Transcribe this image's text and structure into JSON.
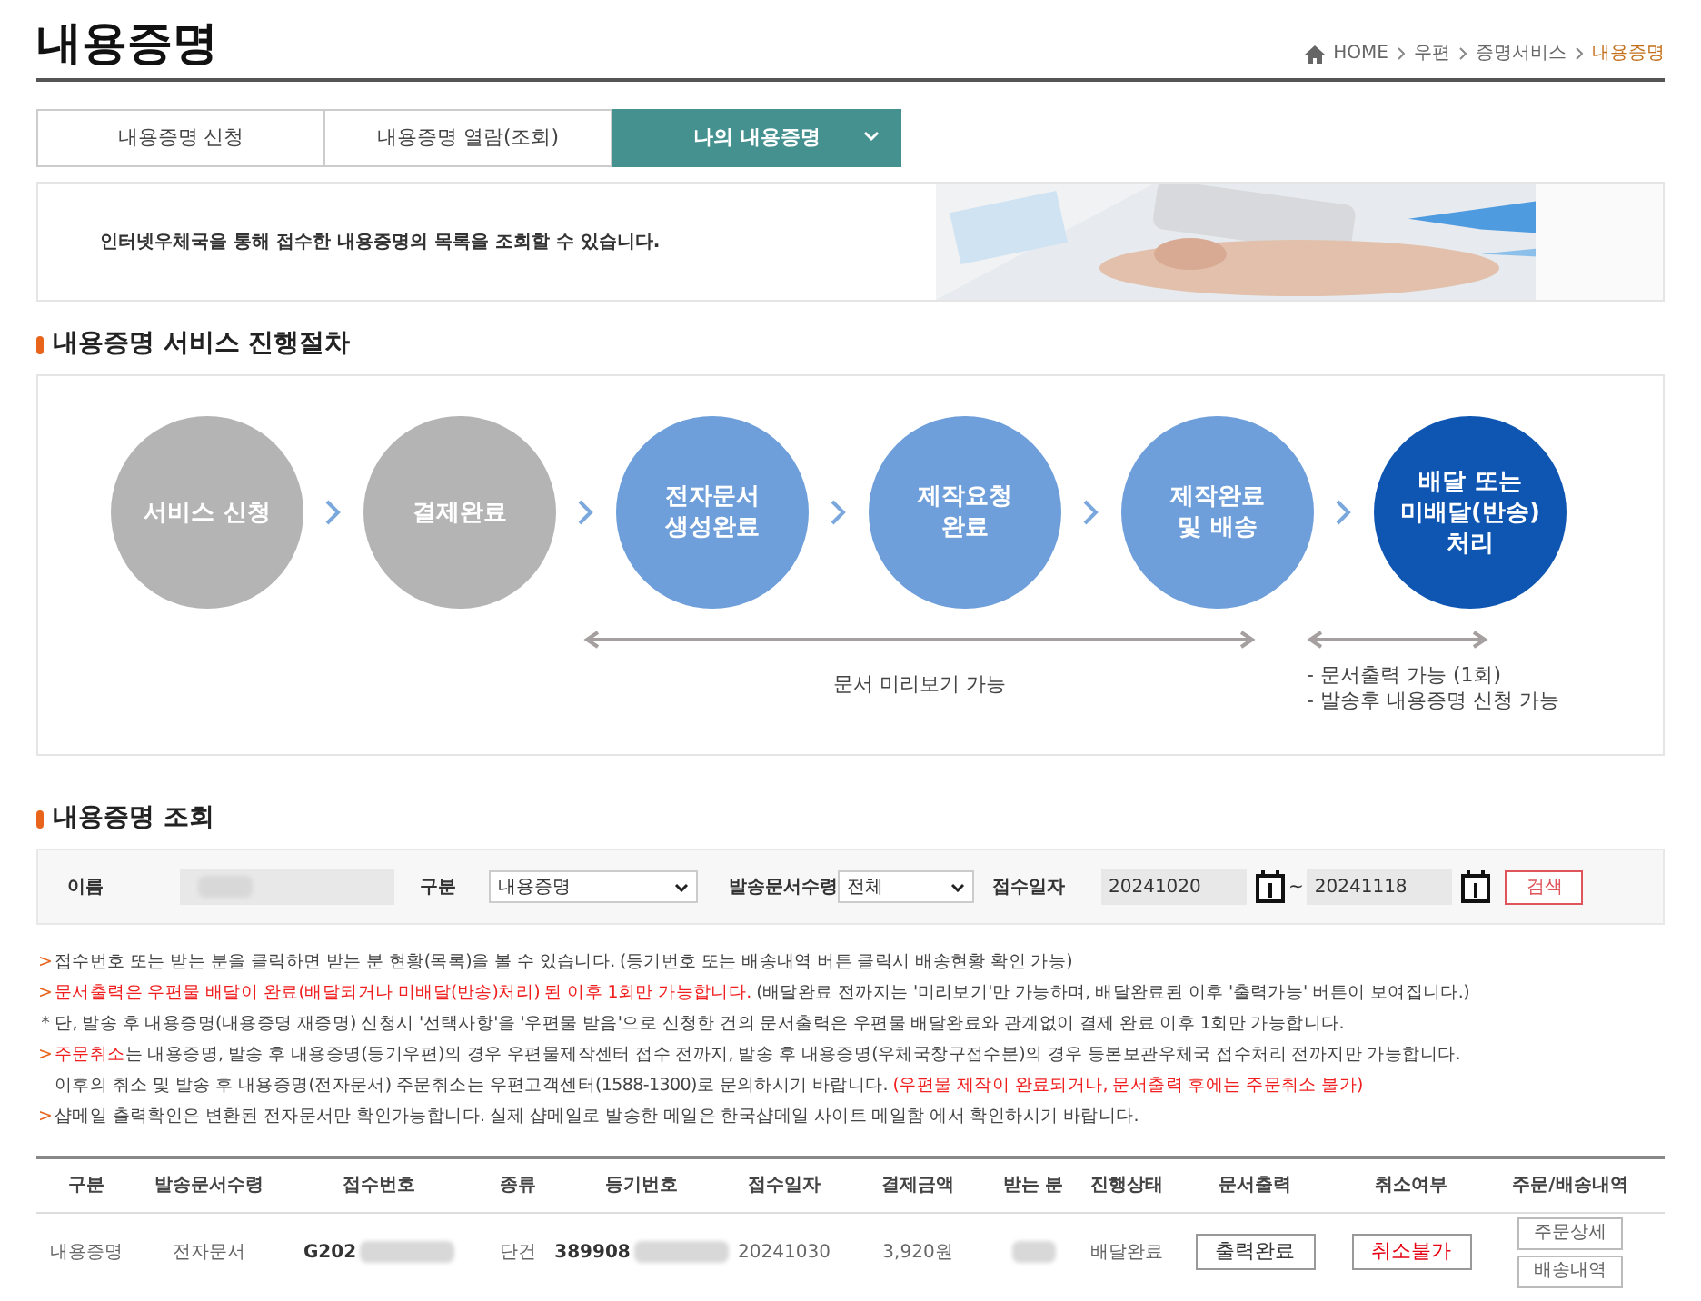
{
  "page_title": "내용증명",
  "breadcrumb": [
    {
      "label": "HOME",
      "selected": false
    },
    {
      "label": "우편",
      "selected": false
    },
    {
      "label": "증명서비스",
      "selected": false
    },
    {
      "label": "내용증명",
      "selected": true
    }
  ],
  "tabs": [
    {
      "label": "내용증명 신청",
      "selected": false
    },
    {
      "label": "내용증명 열람(조회)",
      "selected": false
    },
    {
      "label": "나의 내용증명",
      "selected": true
    }
  ],
  "banner": {
    "text": "인터넷우체국을 통해 접수한 내용증명의 목록을 조회할 수 있습니다."
  },
  "process": {
    "heading": "내용증명 서비스 진행절차",
    "steps": [
      {
        "lines": [
          "서비스 신청"
        ],
        "color": "#b4b4b4"
      },
      {
        "lines": [
          "결제완료"
        ],
        "color": "#b4b4b4"
      },
      {
        "lines": [
          "전자문서",
          "생성완료"
        ],
        "color": "#6e9fda"
      },
      {
        "lines": [
          "제작요청",
          "완료"
        ],
        "color": "#6e9fda"
      },
      {
        "lines": [
          "제작완료",
          "및 배송"
        ],
        "color": "#6e9fda"
      },
      {
        "lines": [
          "배달 또는",
          "미배달(반송)",
          "처리"
        ],
        "color": "#0f56b3"
      }
    ],
    "preview_note": "문서 미리보기 가능",
    "final_notes": [
      "- 문서출력 가능 (1회)",
      "- 발송후 내용증명 신청 가능"
    ]
  },
  "search": {
    "heading": "내용증명 조회",
    "name_label": "이름",
    "type_label": "구분",
    "type_value": "내용증명",
    "receive_label": "발송문서수령",
    "receive_value": "전체",
    "date_label": "접수일자",
    "date_from": "20241020",
    "date_sep": "~",
    "date_to": "20241118",
    "search_button": "검색"
  },
  "notes": [
    {
      "marker": ">",
      "segments": [
        {
          "text": "접수번호 또는 받는 분을 클릭하면 받는 분 현황(목록)을 볼 수 있습니다. (등기번호 또는 배송내역 버튼 클릭시 배송현황 확인 가능)",
          "highlight": false
        }
      ]
    },
    {
      "marker": ">",
      "segments": [
        {
          "text": "문서출력은 우편물 배달이 완료(배달되거나 미배달(반송)처리) 된 이후 1회만 가능합니다.",
          "highlight": true
        },
        {
          "text": " (배달완료 전까지는 '미리보기'만 가능하며, 배달완료된 이후 '출력가능' 버튼이 보여집니다.)",
          "highlight": false
        }
      ]
    },
    {
      "marker": "*",
      "segments": [
        {
          "text": "단, 발송 후 내용증명(내용증명 재증명) 신청시 '선택사항'을 '우편물 받음'으로 신청한 건의 문서출력은 우편물 배달완료와 관계없이 결제 완료 이후 1회만 가능합니다.",
          "highlight": false
        }
      ]
    },
    {
      "marker": ">",
      "segments": [
        {
          "text": "주문취소",
          "highlight": true
        },
        {
          "text": "는 내용증명, 발송 후 내용증명(등기우편)의 경우 우편물제작센터 접수 전까지, 발송 후 내용증명(우체국창구접수분)의 경우 등본보관우체국 접수처리 전까지만 가능합니다.",
          "highlight": false
        }
      ]
    },
    {
      "segments": [
        {
          "text": "이후의 취소 및 발송 후 내용증명(전자문서) 주문취소는 우편고객센터(1588-1300)로 문의하시기 바랍니다. ",
          "highlight": false
        },
        {
          "text": "(우편물 제작이 완료되거나, 문서출력 후에는 주문취소 불가)",
          "highlight": true
        }
      ]
    },
    {
      "marker": ">",
      "segments": [
        {
          "text": "샵메일 출력확인은 변환된 전자문서만 확인가능합니다. 실제 샵메일로 발송한 메일은 한국샵메일 사이트 메일함 에서 확인하시기 바랍니다.",
          "highlight": false
        }
      ]
    }
  ],
  "table": {
    "columns": [
      "구분",
      "발송문서수령",
      "접수번호",
      "종류",
      "등기번호",
      "접수일자",
      "결제금액",
      "받는 분",
      "진행상태",
      "문서출력",
      "취소여부",
      "주문/배송내역"
    ],
    "rows": [
      [
        {
          "kind": "text",
          "text": "내용증명"
        },
        {
          "kind": "text",
          "text": "전자문서"
        },
        {
          "kind": "masked",
          "text": "G202"
        },
        {
          "kind": "text",
          "text": "단건"
        },
        {
          "kind": "masked",
          "text": "389908"
        },
        {
          "kind": "text",
          "text": "20241030"
        },
        {
          "kind": "text",
          "text": "3,920원"
        },
        {
          "kind": "hidden"
        },
        {
          "kind": "text",
          "text": "배달완료"
        },
        {
          "kind": "button",
          "text": "출력완료"
        },
        {
          "kind": "alert_button",
          "text": "취소불가"
        },
        {
          "kind": "buttons",
          "texts": [
            "주문상세",
            "배송내역"
          ]
        }
      ]
    ]
  }
}
